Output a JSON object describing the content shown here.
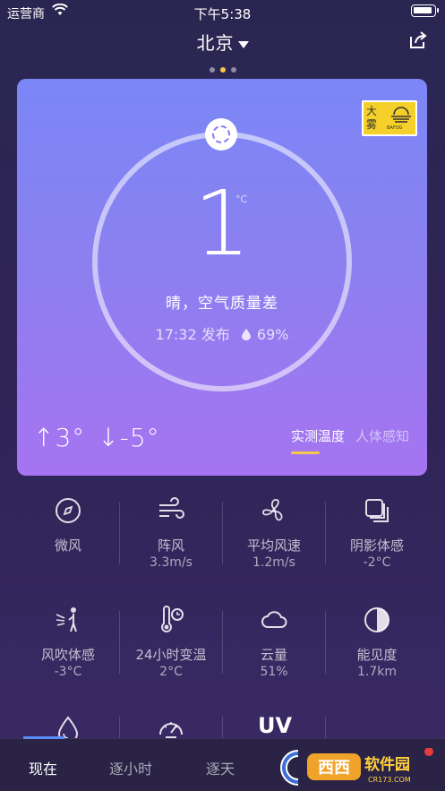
{
  "status": {
    "carrier": "运营商",
    "time": "下午5:38"
  },
  "header": {
    "city": "北京"
  },
  "card": {
    "badge": {
      "label": "大雾",
      "sub": "BAFOG"
    },
    "temperature": "1",
    "unit": "°C",
    "condition": "晴，空气质量差",
    "published": "17:32 发布",
    "humidity": "69%",
    "high": "↑3°",
    "low": "↓-5°",
    "modes": [
      "实测温度",
      "人体感知"
    ]
  },
  "metrics": [
    {
      "label": "微风",
      "value": "",
      "icon": "compass-icon"
    },
    {
      "label": "阵风",
      "value": "3.3m/s",
      "icon": "wind-icon"
    },
    {
      "label": "平均风速",
      "value": "1.2m/s",
      "icon": "fan-icon"
    },
    {
      "label": "阴影体感",
      "value": "-2°C",
      "icon": "shadow-icon"
    },
    {
      "label": "风吹体感",
      "value": "-3°C",
      "icon": "wind-person-icon"
    },
    {
      "label": "24小时变温",
      "value": "2°C",
      "icon": "thermometer-clock-icon"
    },
    {
      "label": "云量",
      "value": "51%",
      "icon": "cloud-icon"
    },
    {
      "label": "能见度",
      "value": "1.7km",
      "icon": "visibility-icon"
    }
  ],
  "partial_row": {
    "uv": "UV"
  },
  "tabs": [
    "现在",
    "逐小时",
    "逐天"
  ],
  "watermark": "西西软件园 CR173.COM"
}
